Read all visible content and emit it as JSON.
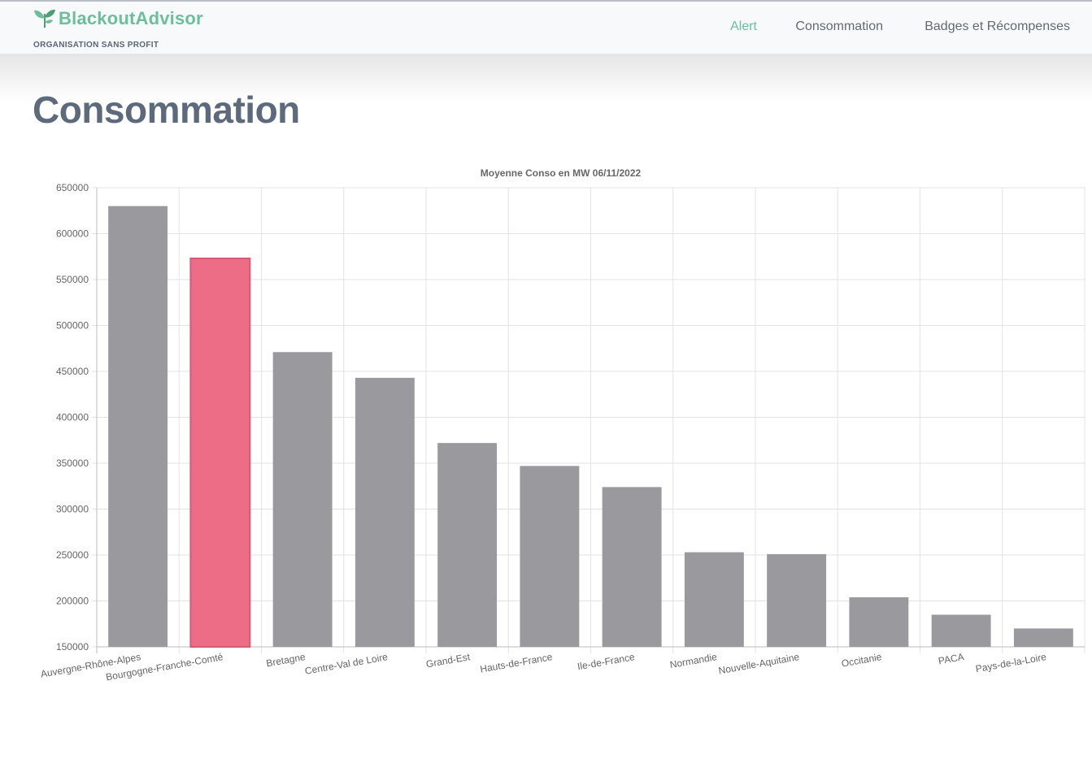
{
  "brand": {
    "name": "BlackoutAdvisor",
    "tagline": "ORGANISATION SANS PROFIT",
    "color": "#6dbf9b"
  },
  "nav": {
    "items": [
      {
        "label": "Alert",
        "active": true
      },
      {
        "label": "Consommation",
        "active": false
      },
      {
        "label": "Badges et Récompenses",
        "active": false
      }
    ]
  },
  "page": {
    "title": "Consommation"
  },
  "chart_data": {
    "type": "bar",
    "title": "Moyenne Conso en MW 06/11/2022",
    "xlabel": "",
    "ylabel": "",
    "categories": [
      "Auvergne-Rhône-Alpes",
      "Bourgogne-Franche-Comté",
      "Bretagne",
      "Centre-Val de Loire",
      "Grand-Est",
      "Hauts-de-France",
      "Ile-de-France",
      "Normandie",
      "Nouvelle-Aquitaine",
      "Occitanie",
      "PACA",
      "Pays-de-la-Loire"
    ],
    "values": [
      630000,
      573000,
      471000,
      443000,
      372000,
      347000,
      324000,
      253000,
      251000,
      204000,
      185000,
      170000
    ],
    "ylim": [
      150000,
      650000
    ],
    "yticks": [
      150000,
      200000,
      250000,
      300000,
      350000,
      400000,
      450000,
      500000,
      550000,
      600000,
      650000
    ],
    "grid": true,
    "highlight_index": 1,
    "colors": {
      "bar": "#9a999e",
      "highlight": "#ec6d85",
      "highlight_border": "#d65a74",
      "grid": "#e3e3e3",
      "axis": "#bdbdbd",
      "text": "#666666"
    }
  }
}
